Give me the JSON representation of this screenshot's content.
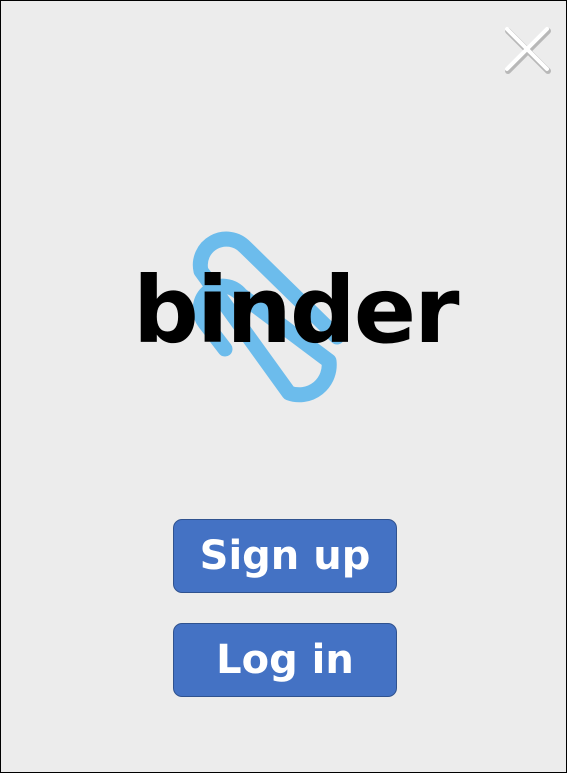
{
  "app": {
    "logo_text": "binder",
    "logo_icon": "paperclip-icon"
  },
  "header": {
    "close_icon": "close-icon"
  },
  "actions": {
    "signup_label": "Sign up",
    "login_label": "Log in"
  },
  "colors": {
    "background": "#ececec",
    "button_fill": "#4472c4",
    "button_border": "#2f528f",
    "button_text": "#ffffff",
    "logo_clip": "#6cbcec",
    "logo_text": "#000000"
  }
}
